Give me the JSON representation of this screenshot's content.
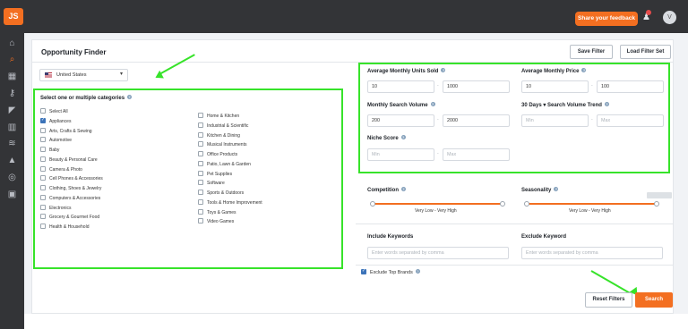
{
  "header": {
    "logo": "JS",
    "feedback_button": "Share your feedback",
    "avatar": "V"
  },
  "sidebar": {
    "icons": [
      "home-icon",
      "search-icon",
      "grid-icon",
      "key-icon",
      "megaphone-icon",
      "chart-icon",
      "layers-icon",
      "graduation-icon",
      "globe-icon",
      "cart-icon"
    ]
  },
  "page": {
    "title": "Opportunity Finder",
    "save_filter": "Save Filter",
    "load_filter_set": "Load Filter Set",
    "marketplace": "United States",
    "categories_title": "Select one or multiple categories",
    "categories_left": [
      "Select All",
      "Appliances",
      "Arts, Crafts & Sewing",
      "Automotive",
      "Baby",
      "Beauty & Personal Care",
      "Camera & Photo",
      "Cell Phones & Accessories",
      "Clothing, Shoes & Jewelry",
      "Computers & Accessories",
      "Electronics",
      "Grocery & Gourmet Food",
      "Health & Household"
    ],
    "categories_right": [
      "Home & Kitchen",
      "Industrial & Scientific",
      "Kitchen & Dining",
      "Musical Instruments",
      "Office Products",
      "Patio, Lawn & Garden",
      "Pet Supplies",
      "Software",
      "Sports & Outdoors",
      "Tools & Home Improvement",
      "Toys & Games",
      "Video Games"
    ],
    "checked_categories": [
      "Appliances"
    ]
  },
  "filters": {
    "avg_monthly_units_sold": {
      "label": "Average Monthly Units Sold",
      "min": "10",
      "max": "1000"
    },
    "avg_monthly_price": {
      "label": "Average Monthly Price",
      "min": "10",
      "max": "100"
    },
    "monthly_search_volume": {
      "label": "Monthly Search Volume",
      "min": "200",
      "max": "2000"
    },
    "search_volume_trend": {
      "label_prefix": "30 Days",
      "label": "Search Volume Trend",
      "min_placeholder": "Min",
      "max_placeholder": "Max"
    },
    "niche_score": {
      "label": "Niche Score",
      "min_placeholder": "Min",
      "max_placeholder": "Max"
    },
    "competition": {
      "label": "Competition",
      "range_text": "Very Low - Very High"
    },
    "seasonality": {
      "label": "Seasonality",
      "range_text": "Very Low - Very High"
    },
    "include_keywords": {
      "label": "Include Keywords",
      "placeholder": "Enter words separated by comma"
    },
    "exclude_keyword": {
      "label": "Exclude Keyword",
      "placeholder": "Enter words separated by comma"
    },
    "exclude_top_brands": "Exclude Top Brands"
  },
  "actions": {
    "reset_filters": "Reset Filters",
    "search": "Search"
  },
  "colors": {
    "accent": "#f36f21",
    "highlight": "#37e32a",
    "sidebar": "#333437"
  }
}
